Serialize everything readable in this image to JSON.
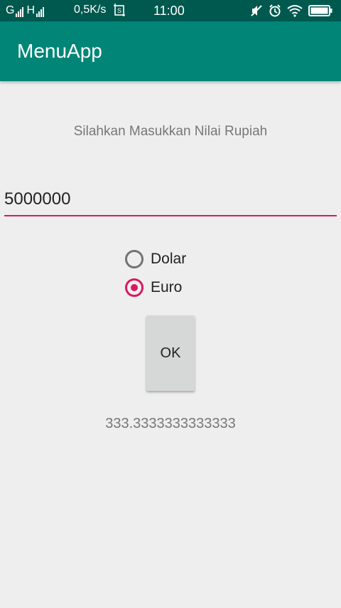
{
  "status_bar": {
    "signal_1_label": "G",
    "signal_2_label": "H",
    "net_speed": "0,5K/s",
    "time": "11:00",
    "icons": [
      "screenshot-icon",
      "mute-icon",
      "alarm-icon",
      "wifi-icon",
      "battery-icon"
    ]
  },
  "app_bar": {
    "title": "MenuApp"
  },
  "form": {
    "prompt": "Silahkan Masukkan  Nilai Rupiah",
    "amount_value": "5000000",
    "options": [
      {
        "label": "Dolar",
        "checked": false
      },
      {
        "label": "Euro",
        "checked": true
      }
    ],
    "ok_label": "OK",
    "result": "333.3333333333333"
  },
  "colors": {
    "status_bar": "#00594f",
    "app_bar": "#008577",
    "accent": "#d81b60",
    "background": "#eeeeee"
  }
}
